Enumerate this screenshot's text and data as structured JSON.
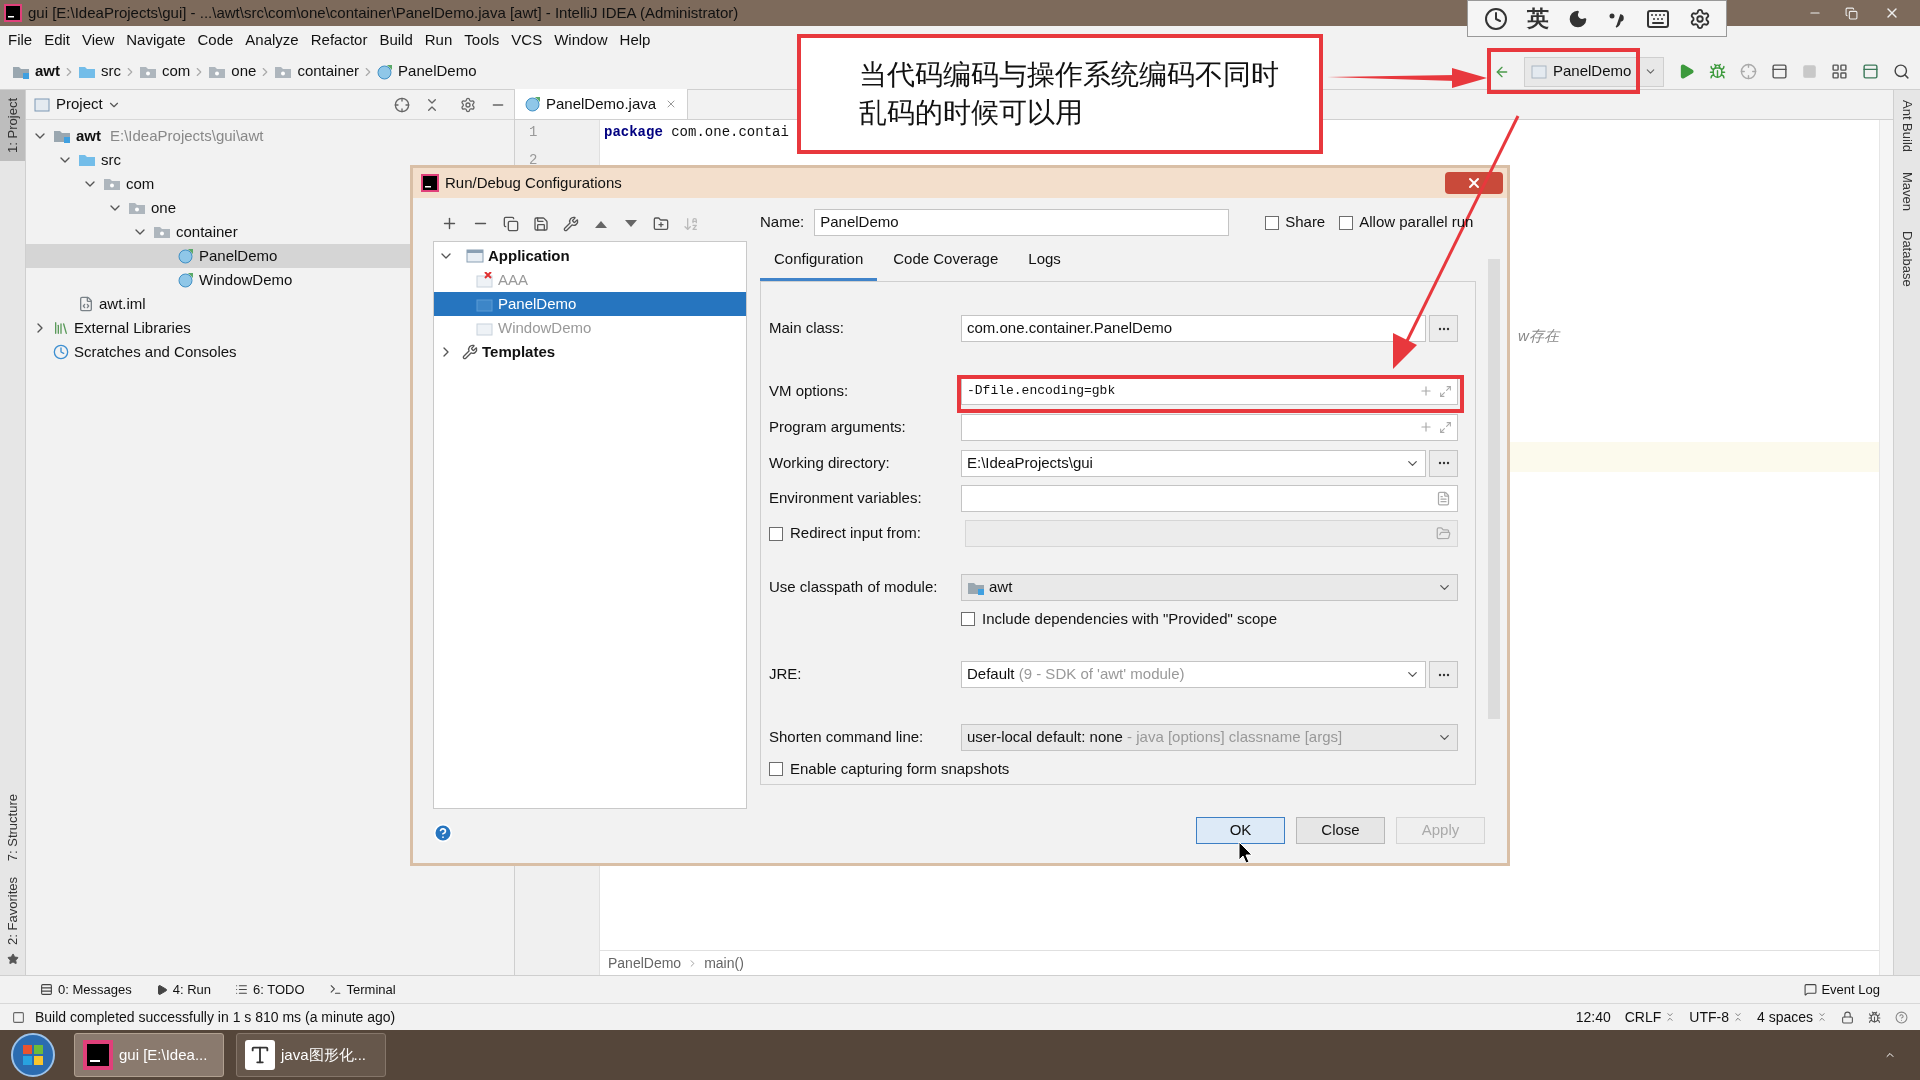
{
  "window": {
    "title": "gui [E:\\IdeaProjects\\gui] - ...\\awt\\src\\com\\one\\container\\PanelDemo.java [awt] - IntelliJ IDEA (Administrator)"
  },
  "ime_toolbar": {
    "language": "英"
  },
  "menu": [
    "File",
    "Edit",
    "View",
    "Navigate",
    "Code",
    "Analyze",
    "Refactor",
    "Build",
    "Run",
    "Tools",
    "VCS",
    "Window",
    "Help"
  ],
  "breadcrumbs": [
    {
      "label": "awt",
      "kind": "module"
    },
    {
      "label": "src",
      "kind": "source"
    },
    {
      "label": "com",
      "kind": "package"
    },
    {
      "label": "one",
      "kind": "package"
    },
    {
      "label": "container",
      "kind": "package"
    },
    {
      "label": "PanelDemo",
      "kind": "class"
    }
  ],
  "run_config": {
    "label": "PanelDemo"
  },
  "left_tool_tabs": [
    {
      "label": "1: Project",
      "selected": true
    },
    {
      "label": "7: Structure",
      "selected": false
    },
    {
      "label": "2: Favorites",
      "selected": false
    }
  ],
  "right_tool_tabs": [
    "Ant Build",
    "Maven",
    "Database"
  ],
  "project": {
    "title": "Project",
    "tree": [
      {
        "label": "awt",
        "kind": "module",
        "path": "E:\\IdeaProjects\\gui\\awt",
        "expanded": true,
        "selected": false,
        "children": [
          {
            "label": "src",
            "kind": "source",
            "expanded": true,
            "selected": false,
            "children": [
              {
                "label": "com",
                "kind": "package",
                "expanded": true,
                "selected": false,
                "children": [
                  {
                    "label": "one",
                    "kind": "package",
                    "expanded": true,
                    "selected": false,
                    "children": [
                      {
                        "label": "container",
                        "kind": "package",
                        "expanded": true,
                        "selected": false,
                        "children": [
                          {
                            "label": "PanelDemo",
                            "kind": "class",
                            "selected": true
                          },
                          {
                            "label": "WindowDemo",
                            "kind": "class",
                            "selected": false
                          }
                        ]
                      }
                    ]
                  }
                ]
              }
            ]
          },
          {
            "label": "awt.iml",
            "kind": "file",
            "selected": false
          }
        ]
      },
      {
        "label": "External Libraries",
        "kind": "libraries",
        "expanded": false,
        "selected": false
      },
      {
        "label": "Scratches and Consoles",
        "kind": "scratches",
        "selected": false
      }
    ]
  },
  "editor": {
    "tab": "PanelDemo.java",
    "line_numbers": [
      "1",
      "2"
    ],
    "code": "package com.one.contai",
    "hint": "w存在",
    "breadcrumb": [
      "PanelDemo",
      "main()"
    ]
  },
  "annotation": {
    "lines": [
      "当代码编码与操作系统编码不同时",
      "乱码的时候可以用"
    ]
  },
  "dialog": {
    "title": "Run/Debug Configurations",
    "tree": [
      {
        "label": "Application",
        "kind": "group",
        "expanded": true,
        "children": [
          {
            "label": "AAA",
            "kind": "config",
            "error": true,
            "dimmed": true,
            "selected": false
          },
          {
            "label": "PanelDemo",
            "kind": "config",
            "error": false,
            "dimmed": false,
            "selected": true
          },
          {
            "label": "WindowDemo",
            "kind": "config",
            "error": false,
            "dimmed": true,
            "selected": false
          }
        ]
      },
      {
        "label": "Templates",
        "kind": "templates",
        "expanded": false
      }
    ],
    "name_label": "Name:",
    "name": "PanelDemo",
    "options": [
      {
        "label": "Share",
        "checked": false
      },
      {
        "label": "Allow parallel run",
        "checked": false
      }
    ],
    "tabs": [
      {
        "label": "Configuration",
        "selected": true
      },
      {
        "label": "Code Coverage",
        "selected": false
      },
      {
        "label": "Logs",
        "selected": false
      }
    ],
    "fields": [
      {
        "kind": "browse",
        "label": "Main class:",
        "value": "com.one.container.PanelDemo"
      },
      {
        "kind": "expandable",
        "label": "VM options:",
        "value": "-Dfile.encoding=gbk"
      },
      {
        "kind": "expandable",
        "label": "Program arguments:"
      },
      {
        "kind": "dropdown_browse",
        "label": "Working directory:",
        "value": "E:\\IdeaProjects\\gui"
      },
      {
        "kind": "env",
        "label": "Environment variables:"
      },
      {
        "kind": "checkbox_path",
        "label": "Redirect input from:",
        "checked": false
      },
      {
        "kind": "module",
        "label": "Use classpath of module:",
        "value": "awt"
      },
      {
        "kind": "checkbox",
        "label": "Include dependencies with \"Provided\" scope",
        "checked": false
      },
      {
        "kind": "jre",
        "label": "JRE:",
        "value": "Default",
        "hint": "(9 - SDK of 'awt' module)"
      },
      {
        "kind": "select",
        "label": "Shorten command line:",
        "value": "user-local default: none",
        "hint": "- java [options] classname [args]"
      },
      {
        "kind": "checkbox",
        "label": "Enable capturing form snapshots",
        "checked": false
      }
    ],
    "buttons": [
      {
        "label": "OK",
        "default": true,
        "disabled": false
      },
      {
        "label": "Close",
        "default": false,
        "disabled": false
      },
      {
        "label": "Apply",
        "default": false,
        "disabled": true
      }
    ]
  },
  "tool_tabs": [
    {
      "label": "0: Messages",
      "kind": "messages"
    },
    {
      "label": "4: Run",
      "kind": "run"
    },
    {
      "label": "6: TODO",
      "kind": "todo"
    },
    {
      "label": "Terminal",
      "kind": "terminal"
    }
  ],
  "event_log": "Event Log",
  "status_bar": {
    "message": "Build completed successfully in 1 s 810 ms (a minute ago)",
    "items": [
      "12:40",
      "CRLF",
      "UTF-8",
      "4 spaces"
    ]
  },
  "taskbar": [
    {
      "label": "gui [E:\\Idea...",
      "kind": "idea",
      "selected": true
    },
    {
      "label": "java图形化...",
      "kind": "text",
      "selected": false
    }
  ]
}
